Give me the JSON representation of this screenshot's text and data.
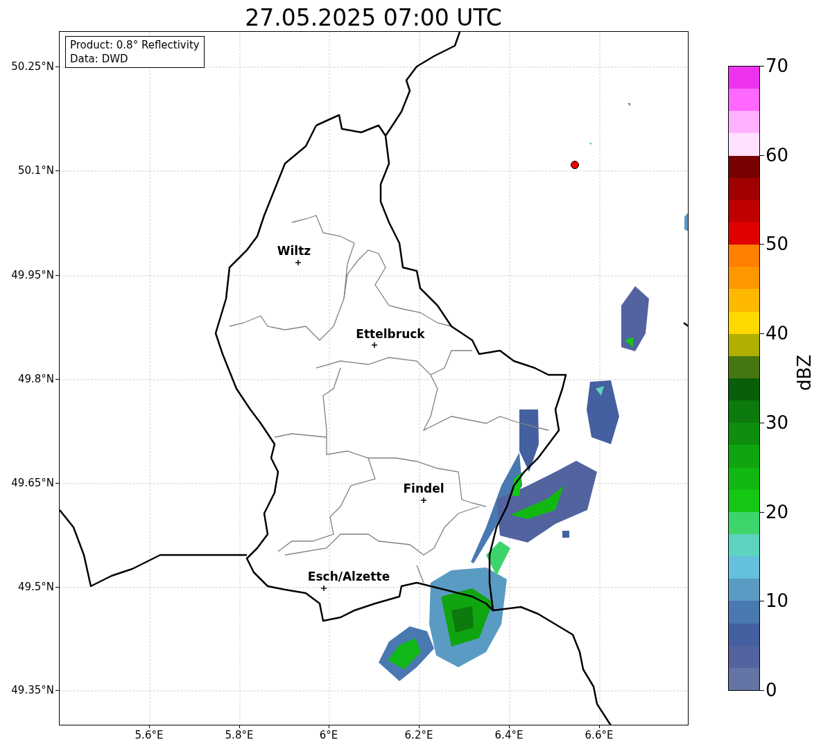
{
  "title": "27.05.2025 07:00 UTC",
  "info_box": [
    "Product: 0.8° Reflectivity",
    "Data: DWD"
  ],
  "map": {
    "x_ticks": [
      "5.6°E",
      "5.8°E",
      "6°E",
      "6.2°E",
      "6.4°E",
      "6.6°E"
    ],
    "y_ticks": [
      "50.25°N",
      "50.1°N",
      "49.95°N",
      "49.8°N",
      "49.65°N",
      "49.5°N",
      "49.35°N"
    ],
    "places": [
      {
        "name": "Wiltz"
      },
      {
        "name": "Ettelbruck"
      },
      {
        "name": "Findel"
      },
      {
        "name": "Esch/Alzette"
      }
    ]
  },
  "colorbar": {
    "label": "dBZ",
    "ticks": [
      "70",
      "60",
      "50",
      "40",
      "30",
      "20",
      "10",
      "0"
    ],
    "bins": [
      {
        "color": "#6474a4"
      },
      {
        "color": "#52639f"
      },
      {
        "color": "#4460a0"
      },
      {
        "color": "#4a78b0"
      },
      {
        "color": "#5a9bc4"
      },
      {
        "color": "#64c0dc"
      },
      {
        "color": "#5ed4c0"
      },
      {
        "color": "#3ed46c"
      },
      {
        "color": "#14c814"
      },
      {
        "color": "#12b812"
      },
      {
        "color": "#10a410"
      },
      {
        "color": "#0e8e0e"
      },
      {
        "color": "#0c7a0c"
      },
      {
        "color": "#095f09"
      },
      {
        "color": "#457810"
      },
      {
        "color": "#b0b000"
      },
      {
        "color": "#ffd800"
      },
      {
        "color": "#ffb800"
      },
      {
        "color": "#ff9800"
      },
      {
        "color": "#ff7f00"
      },
      {
        "color": "#e00000"
      },
      {
        "color": "#c00000"
      },
      {
        "color": "#a00000"
      },
      {
        "color": "#780000"
      },
      {
        "color": "#ffe0ff"
      },
      {
        "color": "#ffb0ff"
      },
      {
        "color": "#ff68ff"
      },
      {
        "color": "#ee33ee"
      }
    ]
  }
}
